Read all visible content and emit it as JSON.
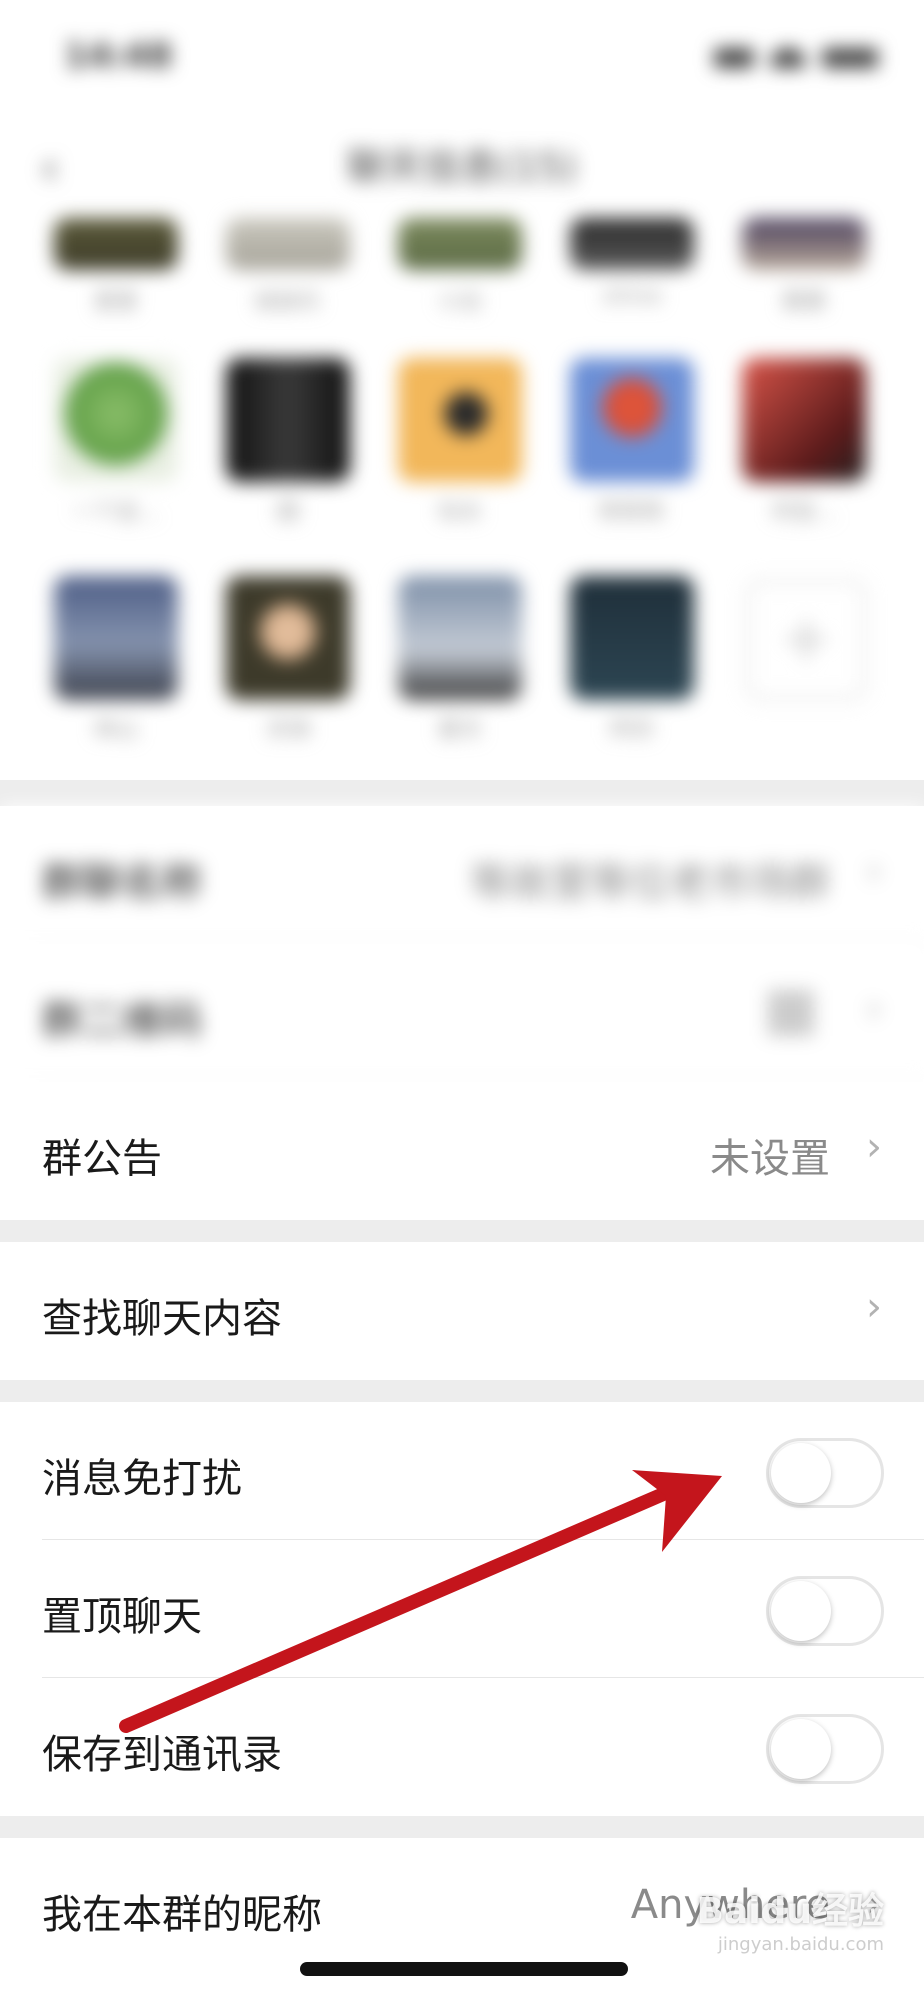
{
  "status_bar": {
    "time": "14:48"
  },
  "nav": {
    "title": "聊天信息(15)"
  },
  "members": {
    "row0": [
      "夏夏",
      "妹妹乐",
      "小白",
      "shine",
      "慕慕"
    ],
    "row1": [
      "一个会...",
      "圆",
      "似水",
      "陈陈陈",
      "何宝..."
    ],
    "row2": [
      "林山",
      "洪涛",
      "夏天",
      "阿宗"
    ]
  },
  "settings": {
    "group_name": {
      "label": "群聊名称",
      "value": "等故里等位老市场群"
    },
    "qr_code": {
      "label": "群二维码"
    },
    "announcement": {
      "label": "群公告",
      "value": "未设置"
    },
    "search_history": {
      "label": "查找聊天内容"
    },
    "mute": {
      "label": "消息免打扰",
      "enabled": false
    },
    "pin": {
      "label": "置顶聊天",
      "enabled": false
    },
    "save_contacts": {
      "label": "保存到通讯录",
      "enabled": false
    },
    "nickname": {
      "label": "我在本群的昵称",
      "value": "Anywhere"
    }
  },
  "watermark": {
    "brand": "Baidu经验",
    "url": "jingyan.baidu.com"
  },
  "colors": {
    "arrow": "#c4151c",
    "section_gap": "#ededed"
  }
}
